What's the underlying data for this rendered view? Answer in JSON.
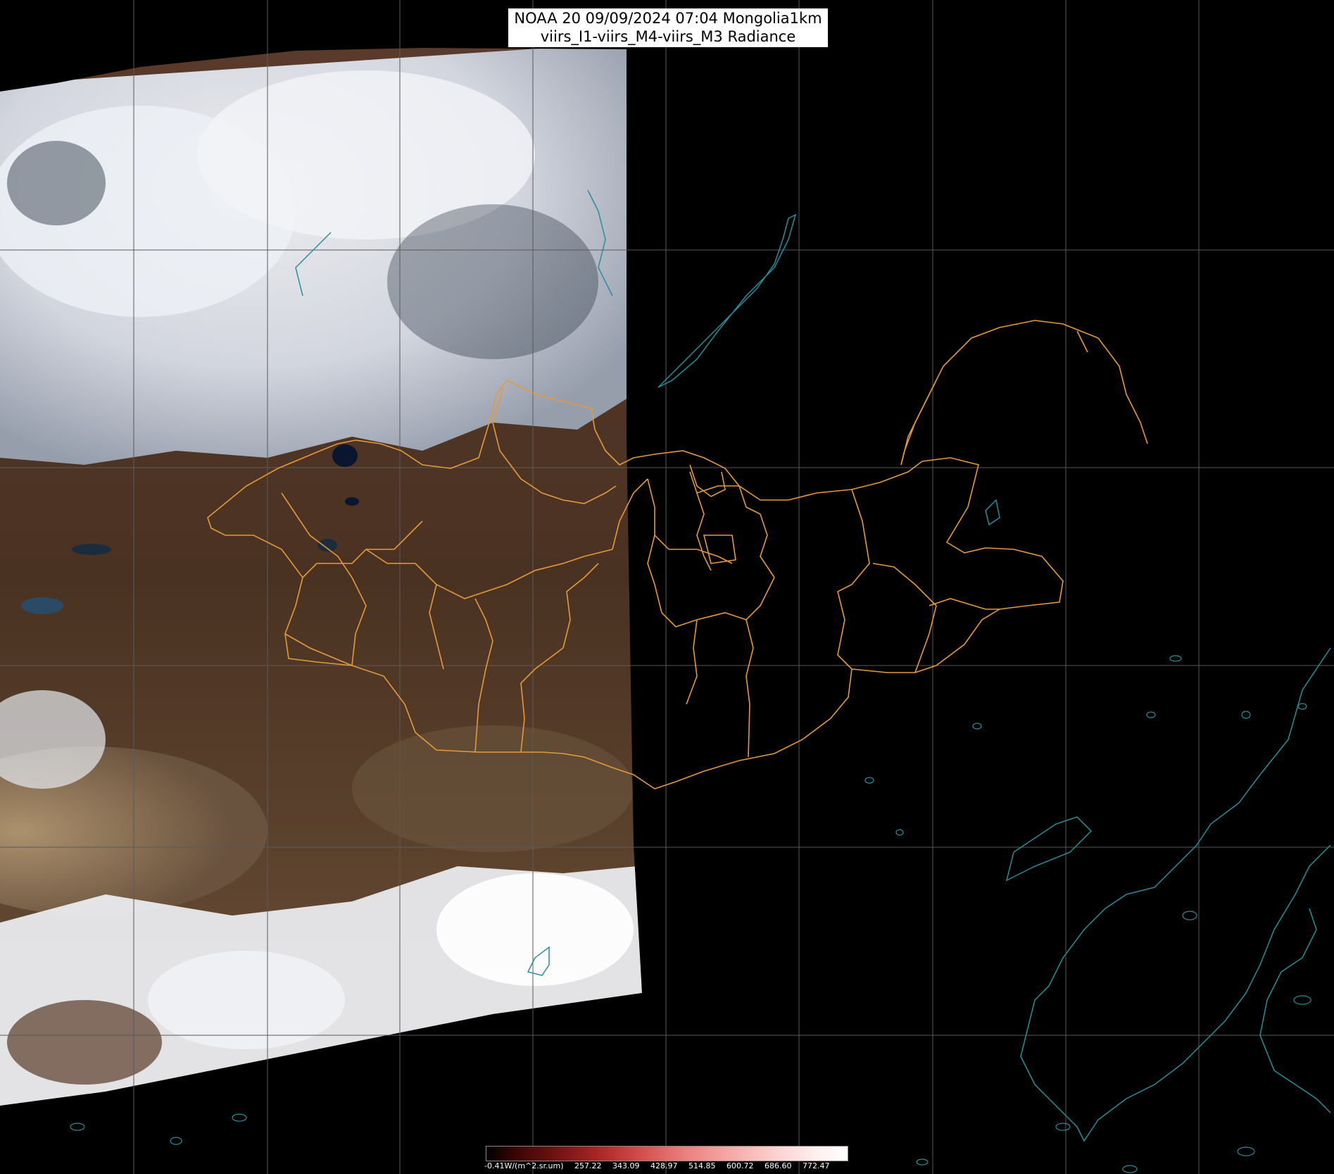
{
  "title": {
    "line1": "NOAA 20 09/09/2024 07:04 Mongolia1km",
    "line2": "viirs_I1-viirs_M4-viirs_M3 Radiance"
  },
  "colorbar": {
    "min_label": "-0.41W/(m^2.sr.um)",
    "ticks": [
      "257.22",
      "343.09",
      "428.97",
      "514.85",
      "600.72",
      "686.60",
      "772.47"
    ]
  },
  "colors": {
    "border": "#e39a3a",
    "coast": "#2a8d9a",
    "grid": "#5a5a5a",
    "cloud": "#e8ecf2",
    "land": "#4a3326",
    "desert": "#9a8060",
    "night": "#000000"
  }
}
